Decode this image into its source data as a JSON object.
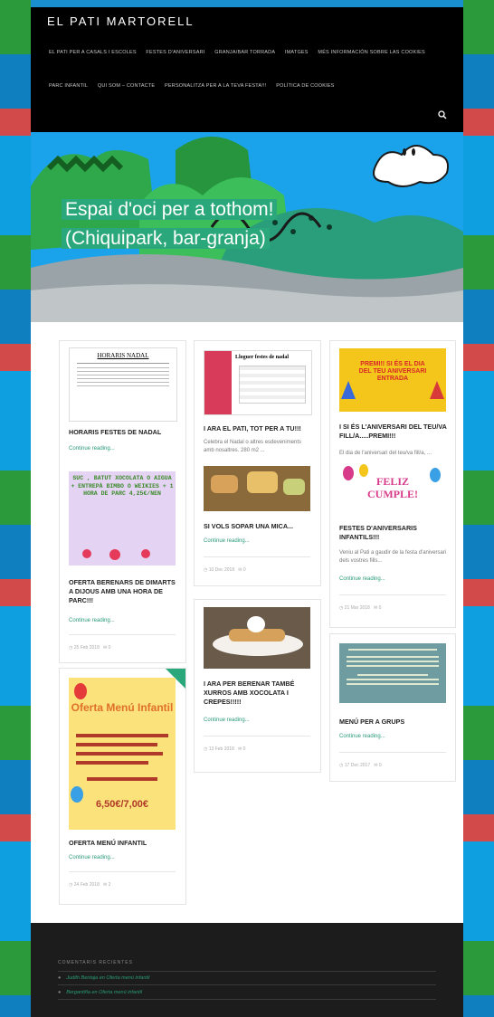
{
  "site": {
    "title": "EL PATI MARTORELL"
  },
  "nav": {
    "row1": [
      "EL PATI PER A CASALS I ESCOLES",
      "FESTES D'ANIVERSARI",
      "GRANJA/BAR TORRADA",
      "IMATGES",
      "MÉS INFORMACIÓN SOBRE LAS COOKIES"
    ],
    "row2": [
      "PARC INFANTIL",
      "QUI SOM – CONTACTE",
      "PERSONALITZA PER A LA TEVA FESTA!!!",
      "POLÍTICA DE COOKIES"
    ]
  },
  "hero": {
    "title": "Espai d'oci per a tothom! (Chiquipark, bar-granja)"
  },
  "posts": {
    "p1": {
      "title": "HORARIS FESTES DE NADAL",
      "more": "Continue reading...",
      "image_title": "HORARIS NADAL"
    },
    "p2": {
      "title": "OFERTA BERENARS DE DIMARTS A DIJOUS AMB UNA HORA DE PARC!!!",
      "more": "Continue reading...",
      "date": "25 Feb 2018",
      "comments": "0",
      "image_text": "SUC , BATUT XOCOLATA O AIGUA + ENTREPÀ BIMBO O WEIKIES + 1 HORA DE PARC 4,25€/NEN"
    },
    "p3": {
      "title": "OFERTA MENÚ INFANTIL",
      "more": "Continue reading...",
      "date": "24 Feb 2018",
      "comments": "2",
      "image_title": "Oferta Menú Infantil",
      "image_price": "6,50€/7,00€"
    },
    "p4": {
      "title": "I ARA EL PATI, TOT PER A TU!!!",
      "excerpt": "Celebra el Nadal o altres esdeveniments amb nosaltres. 280 m2 ...",
      "image_title": "Lloguer festes de nadal"
    },
    "p5": {
      "title": "SI VOLS SOPAR UNA MICA...",
      "more": "Continue reading...",
      "date": "10 Dec 2018",
      "comments": "0"
    },
    "p6": {
      "title": "I ARA PER BERENAR TAMBÉ XURROS AMB XOCOLATA I CREPES!!!!!",
      "more": "Continue reading...",
      "date": "13 Feb 2018",
      "comments": "0"
    },
    "p7": {
      "title": "I SI ÉS L'ANIVERSARI DEL TEU/VA FILL/A.....PREMI!!!",
      "excerpt": "El dia de l'aniversari del teu/va fill/a, ...",
      "image_text": "PREMI!! SI ÉS EL DIA DEL TEU ANIVERSARI ENTRADA"
    },
    "p8": {
      "title": "FESTES D'ANIVERSARIS INFANTILS!!!",
      "excerpt": "Veniu al Pati a gaudir de la festa d'aniversari dels vostres fills...",
      "more": "Continue reading...",
      "date": "21 Mar 2018",
      "comments": "0",
      "image_text": "FELIZ CUMPLE!"
    },
    "p9": {
      "title": "MENÚ PER A GRUPS",
      "more": "Continue reading...",
      "date": "17 Dec 2017",
      "comments": "0"
    }
  },
  "footer": {
    "title": "COMENTARIS RECIENTES",
    "comments": [
      "Judith Bentaja en Oferta menú infantil",
      "Bergantiña en Oferta menú infantil"
    ]
  },
  "colors": {
    "accent": "#2a9a7a",
    "hero_title_bg": "#2aa87c",
    "header_bg": "#000000",
    "footer_bg": "#1c1c1c"
  }
}
